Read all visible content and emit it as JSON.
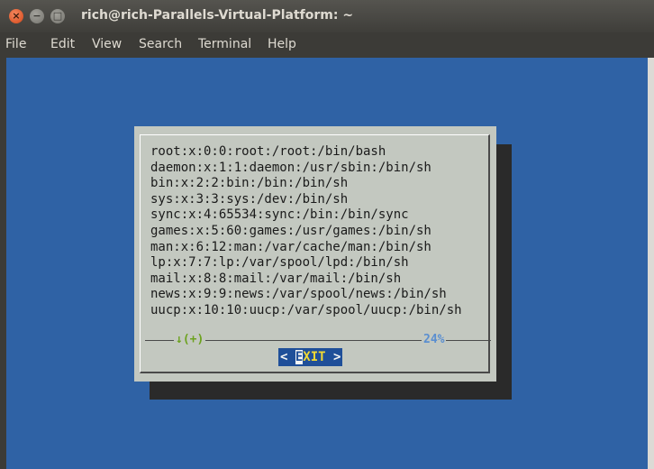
{
  "window": {
    "title": "rich@rich-Parallels-Virtual-Platform: ~",
    "close_glyph": "×",
    "min_glyph": "−",
    "max_glyph": "□"
  },
  "menu": {
    "items": [
      "File",
      "Edit",
      "View",
      "Search",
      "Terminal",
      "Help"
    ]
  },
  "dialog": {
    "lines": [
      "root:x:0:0:root:/root:/bin/bash",
      "daemon:x:1:1:daemon:/usr/sbin:/bin/sh",
      "bin:x:2:2:bin:/bin:/bin/sh",
      "sys:x:3:3:sys:/dev:/bin/sh",
      "sync:x:4:65534:sync:/bin:/bin/sync",
      "games:x:5:60:games:/usr/games:/bin/sh",
      "man:x:6:12:man:/var/cache/man:/bin/sh",
      "lp:x:7:7:lp:/var/spool/lpd:/bin/sh",
      "mail:x:8:8:mail:/var/mail:/bin/sh",
      "news:x:9:9:news:/var/spool/news:/bin/sh",
      "uucp:x:10:10:uucp:/var/spool/uucp:/bin/sh"
    ],
    "more_indicator": "↓(+)",
    "scroll_percent": "24%",
    "exit_button": {
      "left": "< ",
      "hotkey": "E",
      "rest": "XIT",
      "right": " >"
    }
  }
}
